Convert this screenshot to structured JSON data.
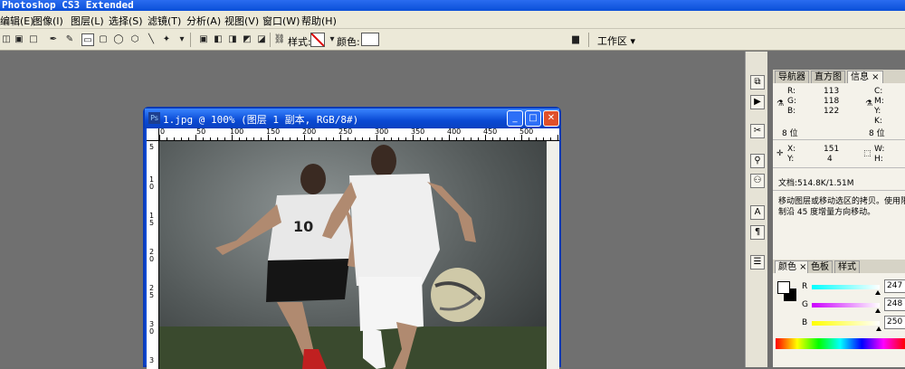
{
  "app": {
    "title": "Photoshop CS3 Extended"
  },
  "menu": [
    "编辑(E)",
    "图像(I)",
    "图层(L)",
    "选择(S)",
    "滤镜(T)",
    "分析(A)",
    "视图(V)",
    "窗口(W)",
    "帮助(H)"
  ],
  "options": {
    "style_label": "样式:",
    "color_label": "颜色:",
    "workspace_label": "工作区"
  },
  "document": {
    "title": "1.jpg @ 100% (图层 1 副本, RGB/8#)",
    "ruler_h": [
      "0",
      "50",
      "100",
      "150",
      "200",
      "250",
      "300",
      "350",
      "400",
      "450",
      "500"
    ],
    "ruler_v": [
      "5",
      "1",
      "0",
      "1",
      "5",
      "2",
      "0",
      "2",
      "5",
      "3",
      "0",
      "3"
    ]
  },
  "panels": {
    "top_tabs": [
      "导航器",
      "直方图",
      "信息"
    ],
    "info": {
      "R": "113",
      "G": "118",
      "B": "122",
      "C": "C:",
      "M": "M:",
      "Y": "Y:",
      "K": "K:",
      "bits": "8 位",
      "bits2": "8 位",
      "X": "151",
      "Yv": "4",
      "W": "W:",
      "H": "H:",
      "doc": "文档:514.8K/1.51M",
      "hint": "移动图层或移动选区的拷贝。使用限制沿 45 度增量方向移动。"
    },
    "color_tabs": [
      "颜色",
      "色板",
      "样式"
    ],
    "color": {
      "R": "247",
      "G": "248",
      "B": "250"
    }
  },
  "colors": {
    "title_blue": "#0a4ad4",
    "panel_bg": "#f4f2ea",
    "workspace": "#707070"
  }
}
